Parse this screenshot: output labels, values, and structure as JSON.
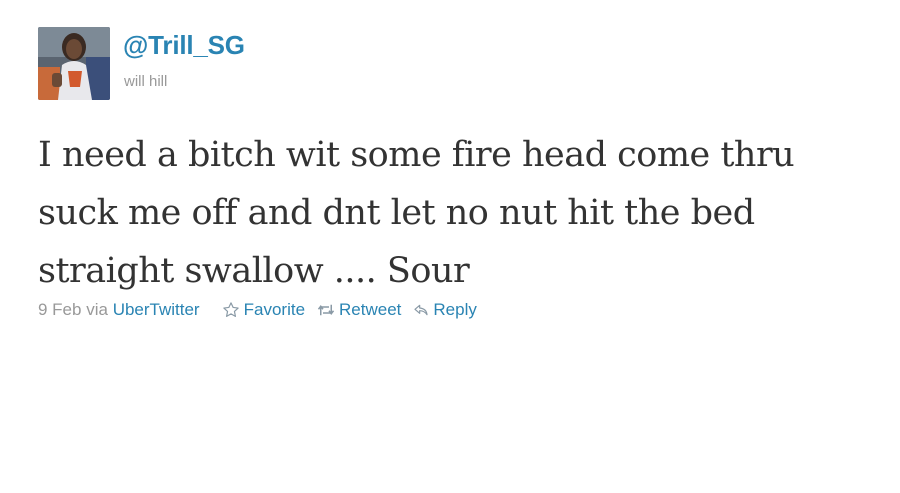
{
  "user": {
    "screen_name": "@Trill_SG",
    "full_name": "will hill"
  },
  "tweet": {
    "text": "I need a bitch wit some fire head come thru suck me off and dnt let no nut hit the bed straight swallow .... Sour",
    "date": "9 Feb",
    "via_label": "via",
    "source": "UberTwitter"
  },
  "actions": {
    "favorite": "Favorite",
    "retweet": "Retweet",
    "reply": "Reply"
  },
  "icons": {
    "favorite": "star-outline-icon",
    "retweet": "retweet-arrows-icon",
    "reply": "reply-arrow-icon"
  },
  "colors": {
    "link": "#2a84b3",
    "meta_text": "#999999",
    "tweet_text": "#333333"
  }
}
